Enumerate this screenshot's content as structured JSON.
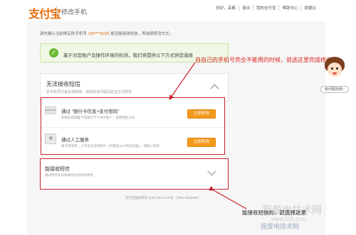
{
  "header": {
    "logo": "支付宝",
    "page_title": "修改手机",
    "links": [
      "你好，采都",
      "退出",
      "我的支付宝",
      "帮助中心",
      "提建议"
    ]
  },
  "notice": {
    "prefix": "请先确认当前绑定的手机号",
    "phone": "156****8225",
    "suffix": "是否能接收短信，再选择修改方式。"
  },
  "info_box": {
    "text": "基于对您账户及操作环境的检测，我们将提供以下方式供您选择"
  },
  "annotation": "自自己的手机号完全不能用的时候，就选这里完成修改",
  "panel_no_sms": {
    "title": "无法接收短信",
    "subtitle": "原手机号已丢失或停用，请用安全问题及验证方式修改"
  },
  "options": [
    {
      "title": "通过 “银行卡信息+支付密码”",
      "subtitle": "如果您是储蓄卡或银行卡下单的账户，请使用此方式",
      "button": "立即修改"
    },
    {
      "title": "通过人工服务",
      "subtitle": "填写申请单，上传身份证件照片（约需在48小时内处理），请耐心等待",
      "button": "立即修改"
    }
  ],
  "panel_sms": {
    "title": "能接收短信",
    "subtitle": "通过原手机号接收短信校验码修改"
  },
  "footer": "支付宝版权所有 2004-2014 ICP证：沪B2-20150087",
  "mascot_label": "有问题找我~",
  "bottom_caption": "能接收短信的，就选择这里",
  "watermark": {
    "text": "我爱电技术网",
    "url": "www.52ij.com",
    "caption": "我爱电技术网"
  },
  "colors": {
    "accent": "#e36c0a",
    "annotation": "#d9261c",
    "button": "#f39a1e",
    "success": "#6ab934"
  }
}
